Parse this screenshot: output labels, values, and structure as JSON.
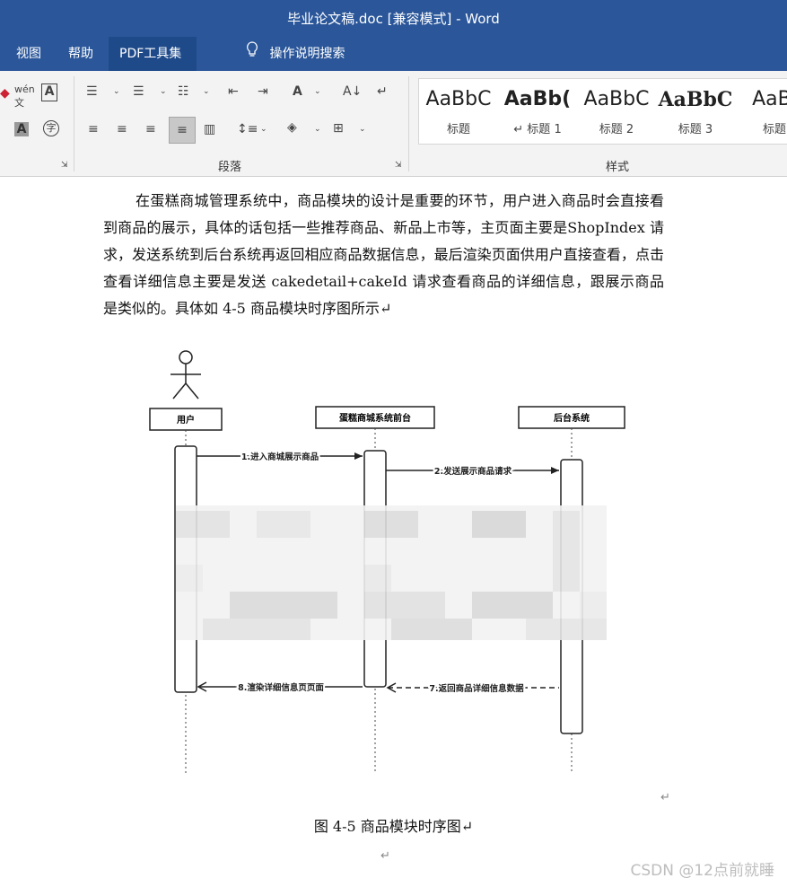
{
  "window": {
    "title": "毕业论文稿.doc [兼容模式]  -  Word"
  },
  "menu": {
    "items": [
      "视图",
      "帮助",
      "PDF工具集"
    ],
    "tellme": "操作说明搜索"
  },
  "ribbon": {
    "paragraph_label": "段落",
    "styles_label": "样式",
    "styles": [
      {
        "sample": "AaBbC",
        "name": "标题"
      },
      {
        "sample": "AaBb(",
        "name": "↵ 标题 1"
      },
      {
        "sample": "AaBbC",
        "name": "标题 2"
      },
      {
        "sample": "AaBbC",
        "name": "标题 3"
      },
      {
        "sample": "AaBl",
        "name": "标题"
      }
    ]
  },
  "document": {
    "paragraph": "在蛋糕商城管理系统中，商品模块的设计是重要的环节，用户进入商品时会直接看到商品的展示，具体的话包括一些推荐商品、新品上市等，主页面主要是ShopIndex 请求，发送系统到后台系统再返回相应商品数据信息，最后渲染页面供用户直接查看，点击查看详细信息主要是发送 cakedetail+cakeId 请求查看商品的详细信息，跟展示商品是类似的。具体如 4-5 商品模块时序图所示↵",
    "caption": "图 4-5 商品模块时序图↵",
    "return_mark": "↵",
    "watermark": "CSDN @12点前就睡"
  },
  "diagram": {
    "lifelines": [
      "用户",
      "蛋糕商城系统前台",
      "后台系统"
    ],
    "messages": [
      "1.进入商城展示商品",
      "2.发送展示商品请求",
      "8.渲染详细信息页页面",
      "7.返回商品详细信息数据"
    ]
  }
}
